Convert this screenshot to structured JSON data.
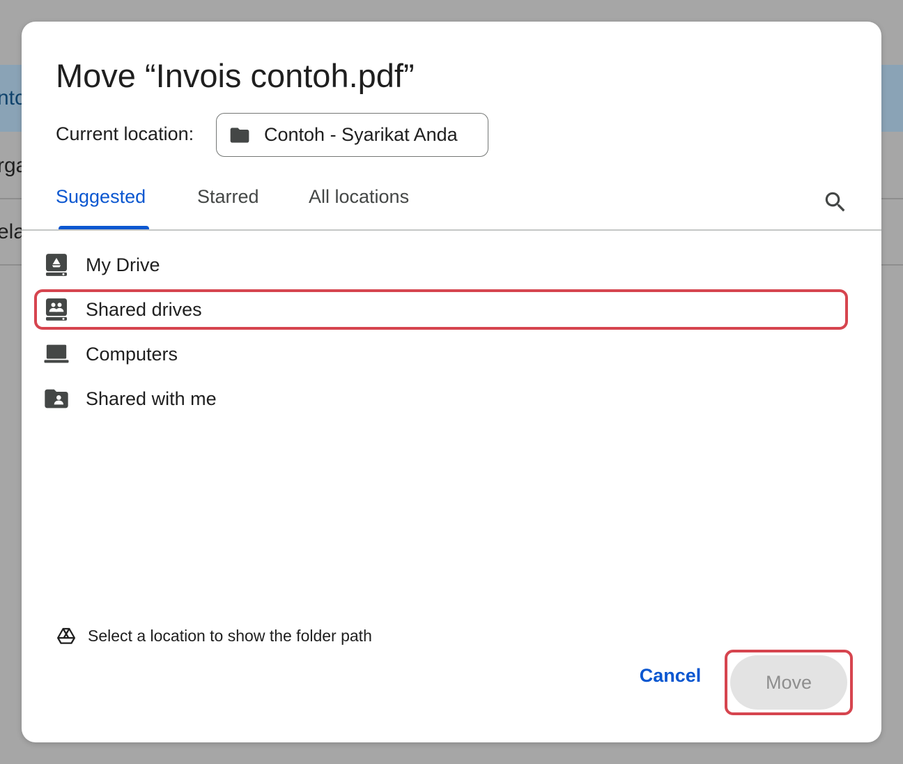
{
  "background": {
    "fragments": [
      "ntc",
      "rga",
      "ela"
    ]
  },
  "dialog": {
    "title": "Move “Invois contoh.pdf”",
    "current_location_label": "Current location:",
    "current_location_value": "Contoh - Syarikat Anda",
    "tabs": [
      {
        "label": "Suggested",
        "active": true
      },
      {
        "label": "Starred",
        "active": false
      },
      {
        "label": "All locations",
        "active": false
      }
    ],
    "items": [
      {
        "label": "My Drive",
        "icon": "my-drive-icon"
      },
      {
        "label": "Shared drives",
        "icon": "shared-drives-icon"
      },
      {
        "label": "Computers",
        "icon": "computer-icon"
      },
      {
        "label": "Shared with me",
        "icon": "shared-with-me-icon"
      }
    ],
    "path_hint": "Select a location to show the folder path",
    "cancel_label": "Cancel",
    "move_label": "Move"
  },
  "colors": {
    "accent": "#0b57d0",
    "highlight": "#d6454f",
    "overlay": "#a6a6a6"
  }
}
